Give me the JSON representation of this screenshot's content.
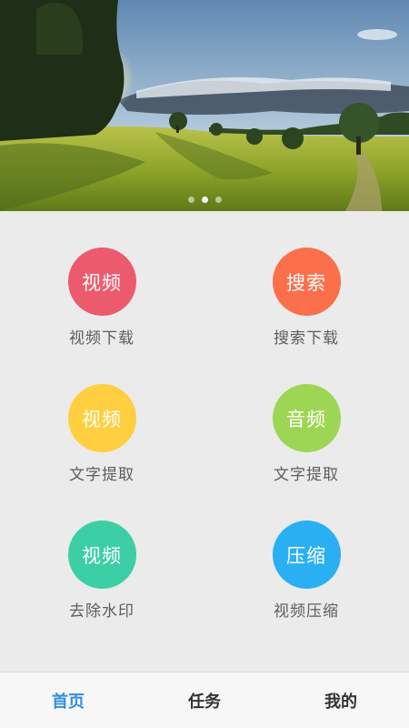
{
  "banner": {
    "image": "landscape-meadow-sunset",
    "slide_count": 3,
    "active_slide": 2
  },
  "features": [
    {
      "circle_text": "视频",
      "label": "视频下载",
      "color": "#ec5b6d"
    },
    {
      "circle_text": "搜索",
      "label": "搜索下载",
      "color": "#fb6f4b"
    },
    {
      "circle_text": "视频",
      "label": "文字提取",
      "color": "#ffcf3f"
    },
    {
      "circle_text": "音频",
      "label": "文字提取",
      "color": "#9dd654"
    },
    {
      "circle_text": "视频",
      "label": "去除水印",
      "color": "#3ccfa5"
    },
    {
      "circle_text": "压缩",
      "label": "视频压缩",
      "color": "#2ab0f2"
    }
  ],
  "nav": {
    "items": [
      {
        "label": "首页",
        "active": true
      },
      {
        "label": "任务",
        "active": false
      },
      {
        "label": "我的",
        "active": false
      }
    ],
    "active_color": "#2f8fe0"
  }
}
